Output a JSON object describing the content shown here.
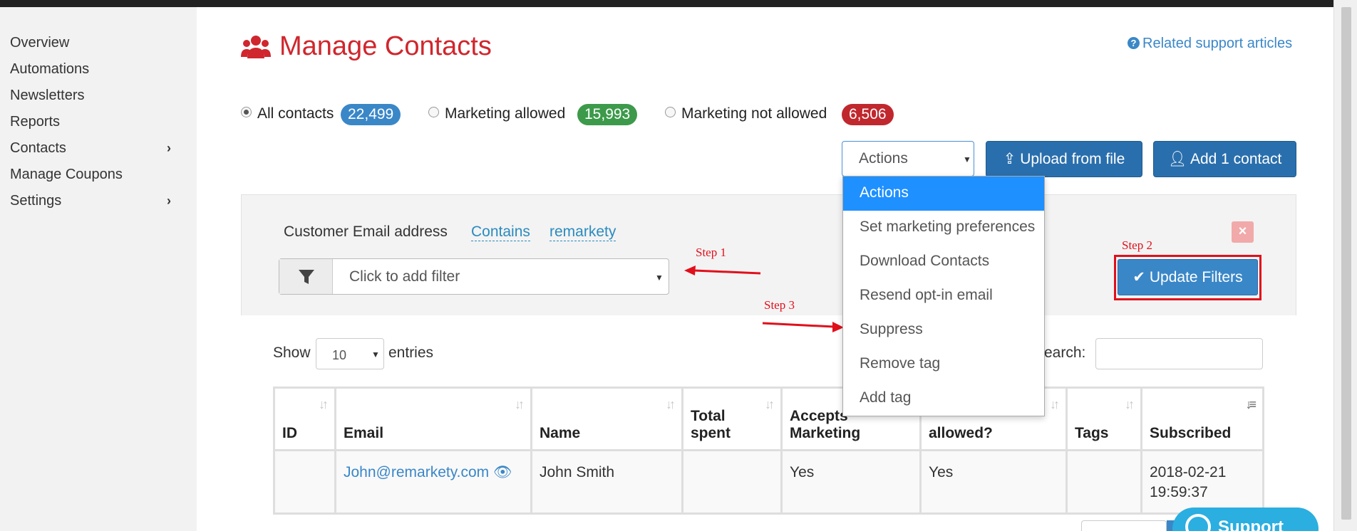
{
  "sidebar": {
    "items": [
      {
        "label": "Overview"
      },
      {
        "label": "Automations"
      },
      {
        "label": "Newsletters"
      },
      {
        "label": "Reports"
      },
      {
        "label": "Contacts",
        "has_submenu": true
      },
      {
        "label": "Manage Coupons"
      },
      {
        "label": "Settings",
        "has_submenu": true
      }
    ]
  },
  "header": {
    "title": "Manage Contacts",
    "title_icon": "users-icon",
    "support_link": "Related support articles"
  },
  "segments": [
    {
      "label": "All contacts",
      "count": "22,499",
      "selected": true,
      "color": "#3a87c8"
    },
    {
      "label": "Marketing allowed",
      "count": "15,993",
      "selected": false,
      "color": "#3c9a4a"
    },
    {
      "label": "Marketing not allowed",
      "count": "6,506",
      "selected": false,
      "color": "#c0282e"
    }
  ],
  "toolbar": {
    "actions_value": "Actions",
    "upload_label": "Upload from file",
    "add_label": "Add 1 contact"
  },
  "filter": {
    "field": "Customer Email address",
    "operator": "Contains",
    "value": "remarkety",
    "placeholder": "Click to add filter",
    "update_label": "Update Filters",
    "close_symbol": "×"
  },
  "annotations": {
    "step1": "Step 1",
    "step2": "Step 2",
    "step3": "Step 3"
  },
  "actions_dropdown": {
    "options": [
      {
        "label": "Actions",
        "selected": true
      },
      {
        "label": "Set marketing preferences"
      },
      {
        "label": "Download Contacts"
      },
      {
        "label": "Resend opt-in email"
      },
      {
        "label": "Suppress"
      },
      {
        "label": "Remove tag"
      },
      {
        "label": "Add tag"
      }
    ]
  },
  "table": {
    "show_label": "Show",
    "entries_value": "10",
    "entries_label": "entries",
    "search_label": "earch:",
    "columns": [
      {
        "line1": "",
        "line2": "ID"
      },
      {
        "line1": "",
        "line2": "Email"
      },
      {
        "line1": "",
        "line2": "Name"
      },
      {
        "line1": "Total",
        "line2": "spent"
      },
      {
        "line1": "Accepts",
        "line2": "Marketing"
      },
      {
        "line1": "",
        "line2": "allowed?"
      },
      {
        "line1": "",
        "line2": "Tags"
      },
      {
        "line1": "",
        "line2": "Subscribed"
      }
    ],
    "rows": [
      {
        "id": "",
        "email": "John@remarkety.com",
        "name": "John Smith",
        "total_spent": "",
        "accepts_marketing": "Yes",
        "allowed": "Yes",
        "tags": "",
        "subscribed_date": "2018-02-21",
        "subscribed_time": "19:59:37"
      }
    ]
  },
  "support_widget": {
    "label": "Support"
  }
}
